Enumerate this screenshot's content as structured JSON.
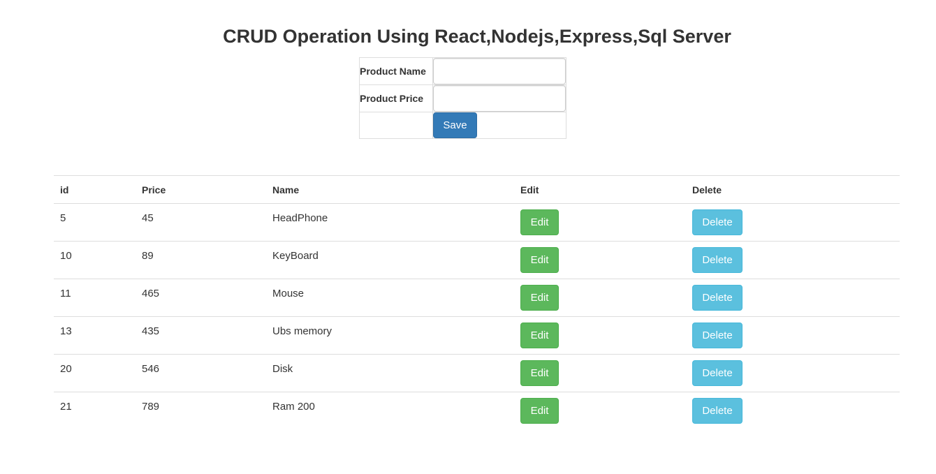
{
  "header": {
    "title": "CRUD Operation Using React,Nodejs,Express,Sql Server"
  },
  "form": {
    "product_name_label": "Product Name",
    "product_name_value": "",
    "product_price_label": "Product Price",
    "product_price_value": "",
    "save_label": "Save",
    "save_color": "#337ab7"
  },
  "table": {
    "columns": [
      "id",
      "Price",
      "Name",
      "Edit",
      "Delete"
    ],
    "edit_label": "Edit",
    "delete_label": "Delete",
    "edit_color": "#5cb85c",
    "delete_color": "#5bc0de",
    "rows": [
      {
        "id": "5",
        "price": "45",
        "name": "HeadPhone"
      },
      {
        "id": "10",
        "price": "89",
        "name": "KeyBoard"
      },
      {
        "id": "11",
        "price": "465",
        "name": "Mouse"
      },
      {
        "id": "13",
        "price": "435",
        "name": "Ubs memory"
      },
      {
        "id": "20",
        "price": "546",
        "name": "Disk"
      },
      {
        "id": "21",
        "price": "789",
        "name": "Ram 200"
      }
    ]
  }
}
